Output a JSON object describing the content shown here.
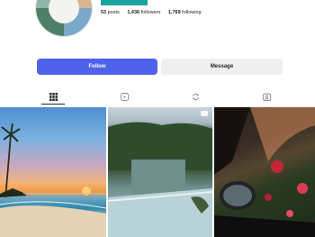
{
  "profile": {
    "avatar_caption": "",
    "stats": {
      "posts_value": "53",
      "posts_label": "posts",
      "followers_value": "1,436",
      "followers_label": "followers",
      "following_value": "1,769",
      "following_label": "following"
    }
  },
  "actions": {
    "follow_label": "Follow",
    "message_label": "Message"
  },
  "tabs": [
    {
      "icon": "grid-icon",
      "active": true
    },
    {
      "icon": "reels-icon",
      "active": false
    },
    {
      "icon": "repost-icon",
      "active": false
    },
    {
      "icon": "tagged-icon",
      "active": false
    }
  ],
  "posts": [
    {
      "type": "photo",
      "overlay_text": ""
    },
    {
      "type": "photo",
      "overlay_text": ""
    },
    {
      "type": "photo",
      "overlay_text": ""
    }
  ],
  "colors": {
    "follow": "#5062ec",
    "message": "#efefef",
    "accent": "#19a3a0"
  }
}
